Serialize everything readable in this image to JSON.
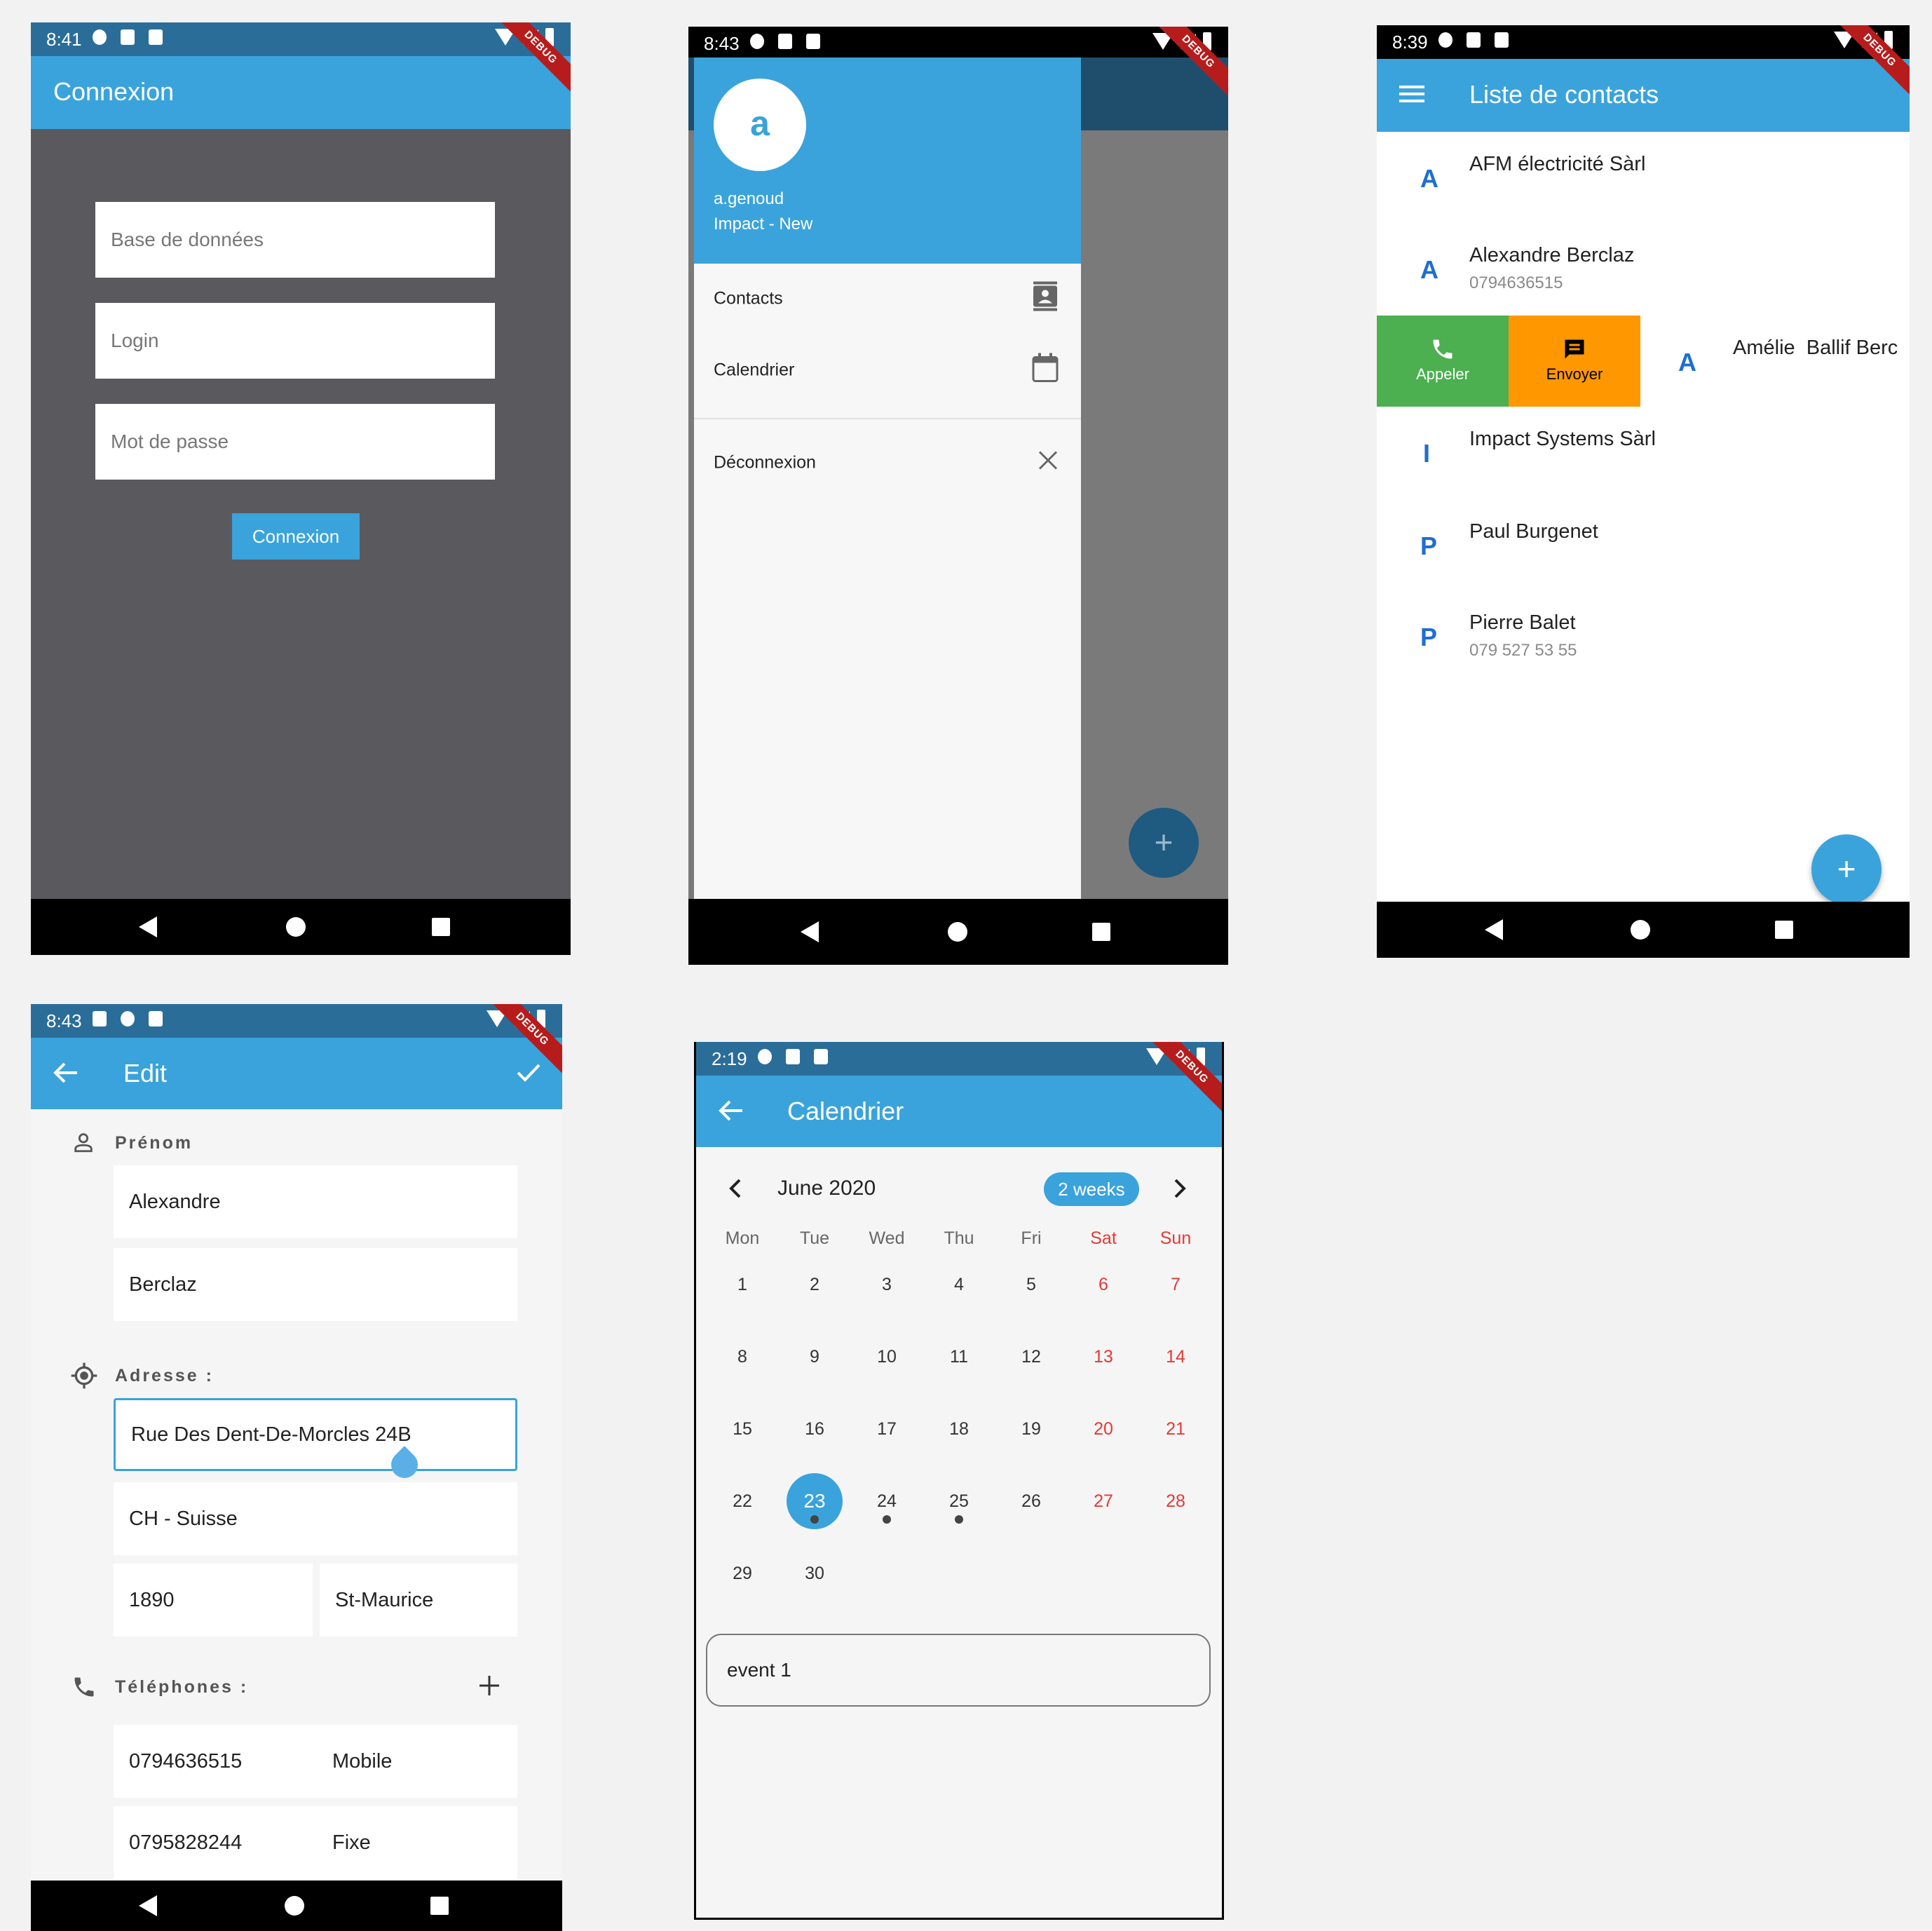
{
  "screens": {
    "login": {
      "status_time": "8:41",
      "debug": "DEBUG",
      "title": "Connexion",
      "fields": [
        "Base de données",
        "Login",
        "Mot de passe"
      ],
      "button": "Connexion"
    },
    "drawer": {
      "status_time": "8:43",
      "debug": "DEBUG",
      "avatar_letter": "a",
      "username": "a.genoud",
      "company": "Impact - New",
      "items": [
        {
          "label": "Contacts",
          "icon": "contacts-icon"
        },
        {
          "label": "Calendrier",
          "icon": "calendar-icon"
        },
        {
          "label": "Déconnexion",
          "icon": "close-icon"
        }
      ],
      "fab": "+"
    },
    "contacts": {
      "status_time": "8:39",
      "debug": "DEBUG",
      "title": "Liste de contacts",
      "items": [
        {
          "letter": "A",
          "name": "AFM électricité Sàrl",
          "phone": ""
        },
        {
          "letter": "A",
          "name": "Alexandre Berclaz",
          "phone": "0794636515"
        },
        {
          "letter": "A",
          "name": "Amélie  Ballif Berc",
          "phone": ""
        },
        {
          "letter": "I",
          "name": "Impact Systems Sàrl",
          "phone": ""
        },
        {
          "letter": "P",
          "name": "Paul Burgenet",
          "phone": ""
        },
        {
          "letter": "P",
          "name": "Pierre Balet",
          "phone": "079 527 53 55"
        }
      ],
      "swipe_actions": {
        "call": "Appeler",
        "send": "Envoyer"
      },
      "fab": "+"
    },
    "edit": {
      "status_time": "8:43",
      "debug": "DEBUG",
      "title": "Edit",
      "prenom_label": "Prénom",
      "first_name": "Alexandre",
      "last_name": "Berclaz",
      "adresse_label": "Adresse :",
      "street": "Rue Des Dent-De-Morcles 24B",
      "country": "CH - Suisse",
      "zip": "1890",
      "city": "St-Maurice",
      "telephones_label": "Téléphones :",
      "phones": [
        {
          "number": "0794636515",
          "type": "Mobile"
        },
        {
          "number": "0795828244",
          "type": "Fixe"
        }
      ]
    },
    "calendar": {
      "status_time": "2:19",
      "debug": "DEBUG",
      "title": "Calendrier",
      "month": "June 2020",
      "format_button": "2 weeks",
      "weekdays": [
        "Mon",
        "Tue",
        "Wed",
        "Thu",
        "Fri",
        "Sat",
        "Sun"
      ],
      "weeks": [
        [
          "1",
          "2",
          "3",
          "4",
          "5",
          "6",
          "7"
        ],
        [
          "8",
          "9",
          "10",
          "11",
          "12",
          "13",
          "14"
        ],
        [
          "15",
          "16",
          "17",
          "18",
          "19",
          "20",
          "21"
        ],
        [
          "22",
          "23",
          "24",
          "25",
          "26",
          "27",
          "28"
        ],
        [
          "29",
          "30",
          "",
          "",
          "",
          "",
          ""
        ]
      ],
      "selected_day": "23",
      "event_days": [
        "23",
        "24",
        "25"
      ],
      "event": "event 1"
    }
  },
  "colors": {
    "primary": "#3aa3db",
    "call": "#4caf50",
    "send": "#ff9800",
    "weekend": "#e53935",
    "login_bg": "#5a5a5e"
  }
}
